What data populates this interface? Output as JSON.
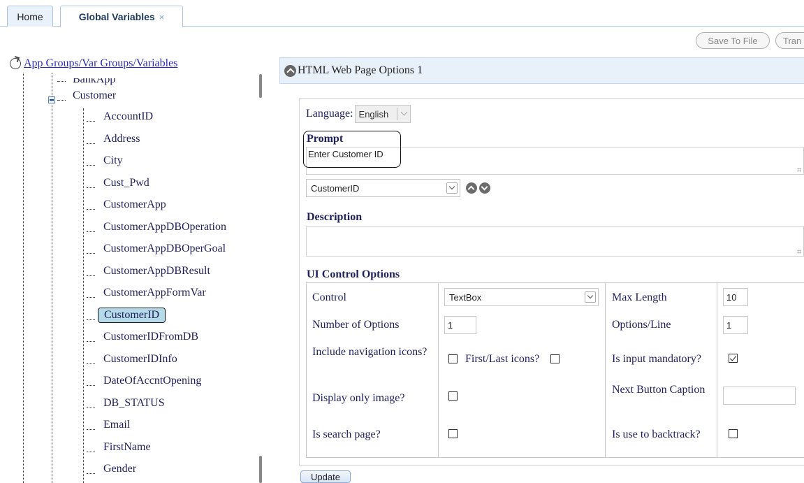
{
  "tabs": {
    "home": "Home",
    "global_variables": "Global Variables",
    "close": "×"
  },
  "toolbar": {
    "save_to_file": "Save To File",
    "tran": "Tran"
  },
  "tree": {
    "root_label": "App Groups/Var Groups/Variables",
    "clipped_item": "BankApp",
    "group": "Customer",
    "items": [
      "AccountID",
      "Address",
      "City",
      "Cust_Pwd",
      "CustomerApp",
      "CustomerAppDBOperation",
      "CustomerAppDBOperGoal",
      "CustomerAppDBResult",
      "CustomerAppFormVar",
      "CustomerID",
      "CustomerIDFromDB",
      "CustomerIDInfo",
      "DateOfAccntOpening",
      "DB_STATUS",
      "Email",
      "FirstName",
      "Gender"
    ],
    "selected": "CustomerID"
  },
  "panel": {
    "title": "HTML Web Page Options 1",
    "language_label": "Language:",
    "language_value": "English",
    "prompt_label": "Prompt",
    "prompt_value": "Enter Customer ID",
    "variable_select": "CustomerID",
    "description_label": "Description",
    "description_value": "",
    "ui_control_options_label": "UI Control Options",
    "options": {
      "control_label": "Control",
      "control_value": "TextBox",
      "max_length_label": "Max Length",
      "max_length_value": "10",
      "number_of_options_label": "Number of Options",
      "number_of_options_value": "1",
      "options_per_line_label": "Options/Line",
      "options_per_line_value": "1",
      "include_nav_label": "Include navigation icons?",
      "include_nav_checked": false,
      "first_last_label": "First/Last icons?",
      "first_last_checked": false,
      "input_mandatory_label": "Is input mandatory?",
      "input_mandatory_checked": true,
      "display_only_image_label": "Display only image?",
      "display_only_image_checked": false,
      "next_button_caption_label": "Next Button Caption",
      "next_button_caption_value": "",
      "is_search_page_label": "Is search page?",
      "is_search_page_checked": false,
      "use_to_backtrack_label": "Is use to backtrack?",
      "use_to_backtrack_checked": false
    },
    "update_button": "Update"
  }
}
